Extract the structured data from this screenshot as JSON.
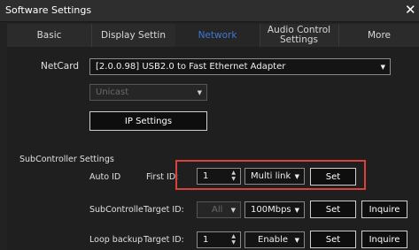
{
  "window": {
    "title": "Software Settings",
    "close_glyph": "✕"
  },
  "tabs": [
    {
      "label": "Basic",
      "active": false
    },
    {
      "label": "Display Settin",
      "active": false
    },
    {
      "label": "Network",
      "active": true
    },
    {
      "label": "Audio Control Settings",
      "active": false
    },
    {
      "label": "More",
      "active": false
    }
  ],
  "netcard": {
    "label": "NetCard",
    "value": "[2.0.0.98] USB2.0 to Fast Ethernet Adapter",
    "mode_value": "Unicast",
    "ip_settings_label": "IP Settings"
  },
  "subcontroller": {
    "section_title": "SubController Settings",
    "auto_id": {
      "label": "Auto ID",
      "first_id_label": "First ID:",
      "first_id_value": "1",
      "link_mode": "Multi link",
      "set_label": "Set"
    },
    "subcontroller_row": {
      "label": "SubControlle",
      "target_id_label": "Target ID:",
      "target_value": "All",
      "speed_value": "100Mbps",
      "set_label": "Set",
      "inquire_label": "Inquire"
    },
    "loop_backup_row": {
      "label": "Loop backup",
      "target_id_label": "Target ID:",
      "target_value": "1",
      "enable_value": "Enable",
      "set_label": "Set",
      "inquire_label": "Inquire"
    }
  },
  "colors": {
    "active_tab": "#3d78d8",
    "highlight": "#d9423b",
    "background": "#1f1f1f"
  },
  "icons": [
    "close-icon",
    "dropdown-arrow-icon",
    "spinner-arrows-icon"
  ]
}
